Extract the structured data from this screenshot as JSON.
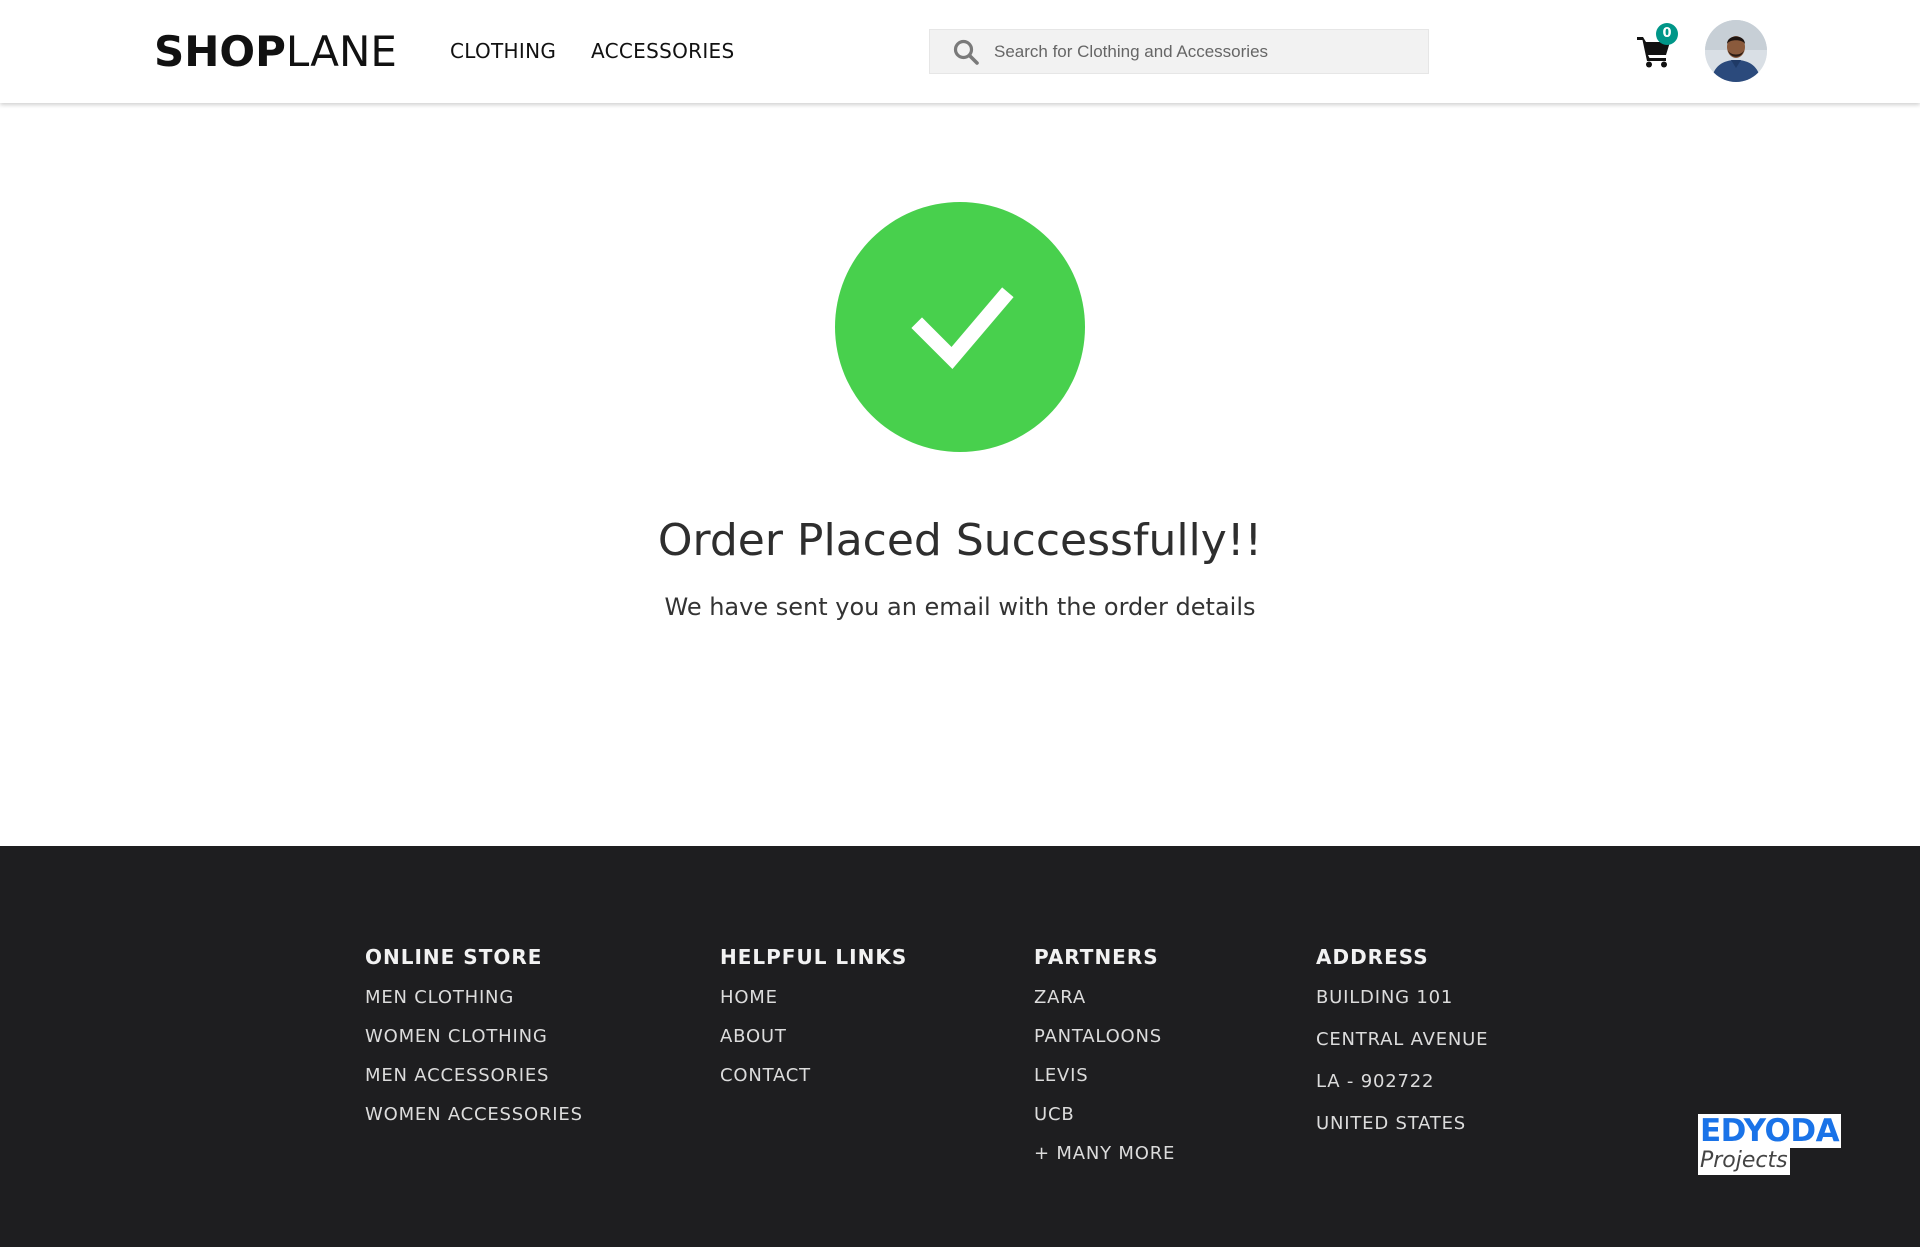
{
  "header": {
    "logo_bold": "SHOP",
    "logo_light": "LANE",
    "nav": [
      {
        "label": "CLOTHING"
      },
      {
        "label": "ACCESSORIES"
      }
    ],
    "search": {
      "placeholder": "Search for Clothing and Accessories",
      "value": ""
    },
    "cart": {
      "count": "0",
      "badge_color": "#009688"
    }
  },
  "main": {
    "title": "Order Placed Successfully!!",
    "subtitle": "We have sent you an email with the order details",
    "success_color": "#48d04d"
  },
  "footer": {
    "columns": [
      {
        "heading": "ONLINE STORE",
        "items": [
          "MEN CLOTHING",
          "WOMEN CLOTHING",
          "MEN ACCESSORIES",
          "WOMEN ACCESSORIES"
        ]
      },
      {
        "heading": "HELPFUL LINKS",
        "items": [
          "HOME",
          "ABOUT",
          "CONTACT"
        ]
      },
      {
        "heading": "PARTNERS",
        "items": [
          "ZARA",
          "PANTALOONS",
          "LEVIS",
          "UCB",
          "+ MANY MORE"
        ]
      },
      {
        "heading": "ADDRESS",
        "items": [
          "BUILDING 101",
          "CENTRAL AVENUE",
          "LA - 902722",
          "UNITED STATES"
        ]
      }
    ],
    "watermark": {
      "top": "EDYODA",
      "bottom": "Projects"
    },
    "background": "#1e1e20"
  }
}
